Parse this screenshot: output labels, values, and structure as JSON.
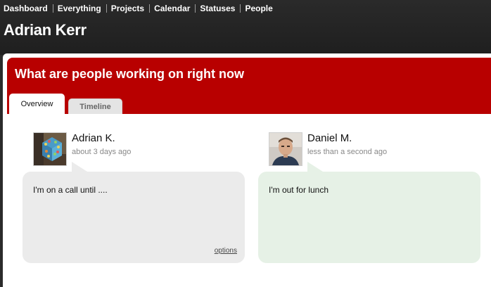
{
  "nav": {
    "items": [
      "Dashboard",
      "Everything",
      "Projects",
      "Calendar",
      "Statuses",
      "People"
    ]
  },
  "page": {
    "title": "Adrian Kerr"
  },
  "header": {
    "title": "What are people working on right now"
  },
  "tabs": {
    "overview": "Overview",
    "timeline": "Timeline"
  },
  "statuses": [
    {
      "author": "Adrian K.",
      "time": "about 3 days ago",
      "text": "I'm on a call until ....",
      "options_label": "options",
      "avatar_icon": "avatar-photo-cube"
    },
    {
      "author": "Daniel M.",
      "time": "less than a second ago",
      "text": "I'm out for lunch",
      "avatar_icon": "avatar-photo-person"
    }
  ],
  "colors": {
    "header_red": "#b80000",
    "top_dark": "#2b2b2b",
    "bubble_grey": "#ebebeb",
    "bubble_green": "#e6f1e6"
  }
}
